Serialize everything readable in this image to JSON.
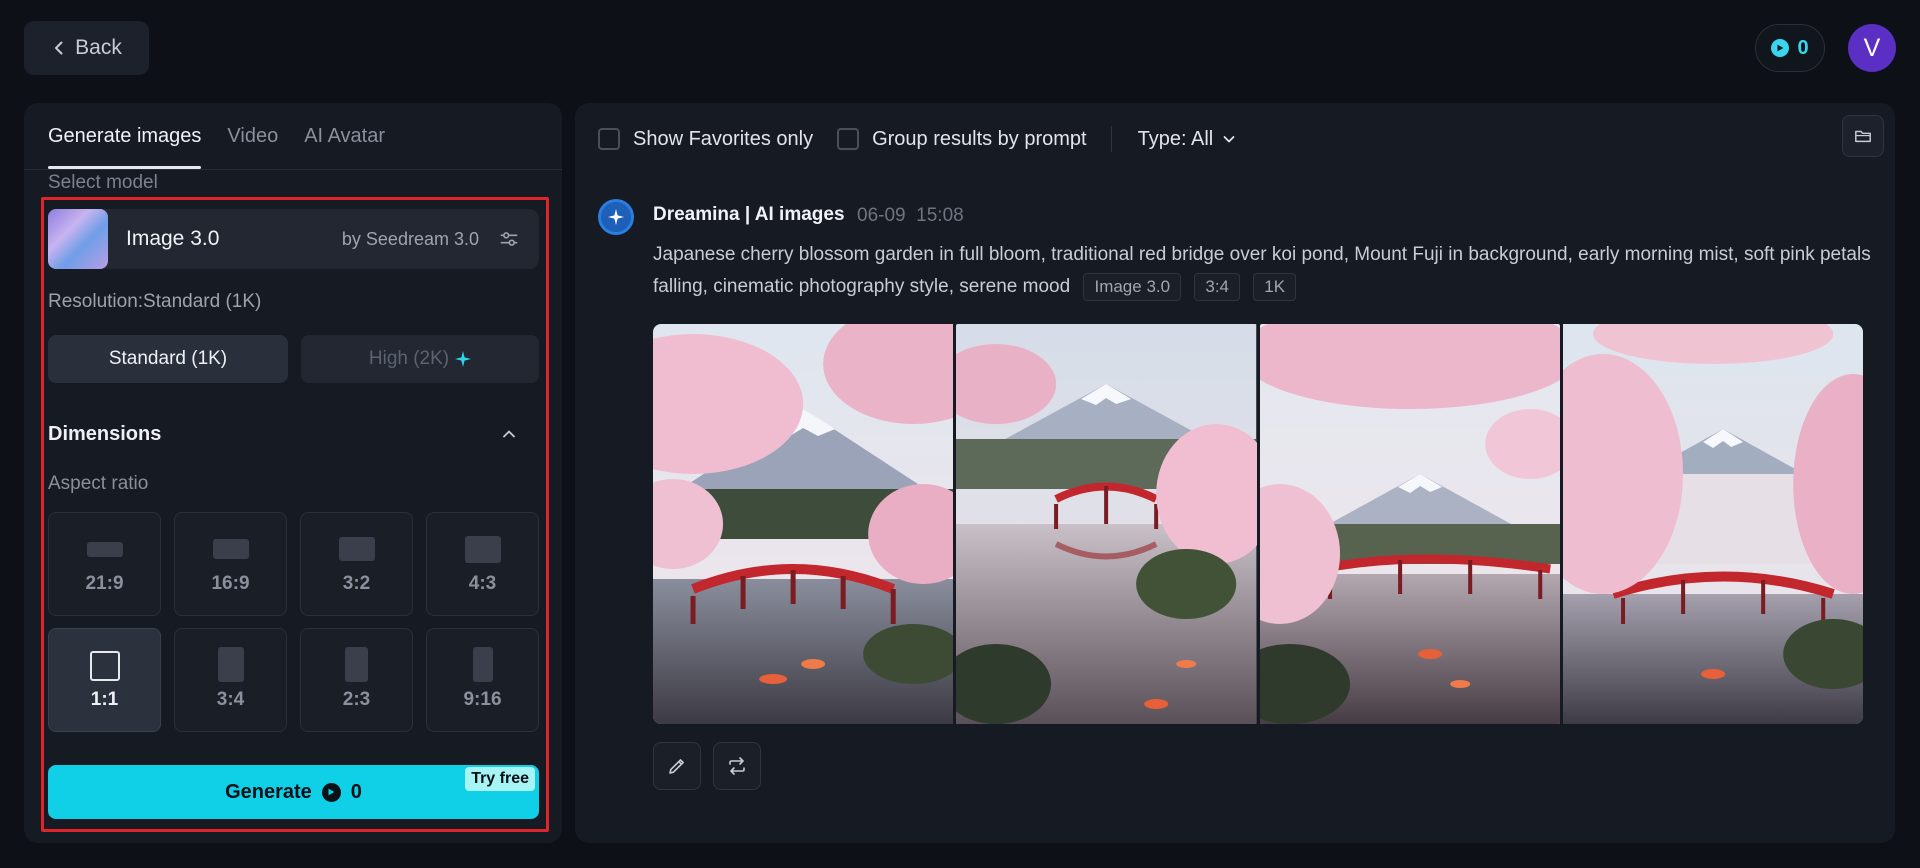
{
  "topbar": {
    "back_label": "Back",
    "credits": "0",
    "avatar_letter": "V"
  },
  "left": {
    "tabs": [
      {
        "label": "Generate images",
        "active": true
      },
      {
        "label": "Video",
        "active": false
      },
      {
        "label": "AI Avatar",
        "active": false
      }
    ],
    "select_model_label": "Select model",
    "model": {
      "name": "Image 3.0",
      "by": "by Seedream 3.0"
    },
    "resolution_label": "Resolution:Standard (1K)",
    "resolution_options": [
      {
        "label": "Standard (1K)",
        "selected": true
      },
      {
        "label": "High (2K)",
        "selected": false
      }
    ],
    "dimensions_title": "Dimensions",
    "aspect_label": "Aspect ratio",
    "ratios": [
      {
        "label": "21:9",
        "selected": false
      },
      {
        "label": "16:9",
        "selected": false
      },
      {
        "label": "3:2",
        "selected": false
      },
      {
        "label": "4:3",
        "selected": false
      },
      {
        "label": "1:1",
        "selected": true
      },
      {
        "label": "3:4",
        "selected": false
      },
      {
        "label": "2:3",
        "selected": false
      },
      {
        "label": "9:16",
        "selected": false
      }
    ],
    "generate_label": "Generate",
    "generate_cost": "0",
    "try_free": "Try free",
    "accent_color": "#0fd0e6",
    "highlight_color": "#e0242a"
  },
  "right": {
    "show_favorites_label": "Show Favorites only",
    "group_results_label": "Group results by prompt",
    "type_label": "Type: All",
    "post": {
      "author": "Dreamina | AI images",
      "date": "06-09",
      "time": "15:08",
      "prompt": "Japanese cherry blossom garden in full bloom, traditional red bridge over koi pond, Mount Fuji in background, early morning mist, soft pink petals falling, cinematic photography style, serene mood",
      "tags": [
        "Image 3.0",
        "3:4",
        "1K"
      ]
    }
  }
}
